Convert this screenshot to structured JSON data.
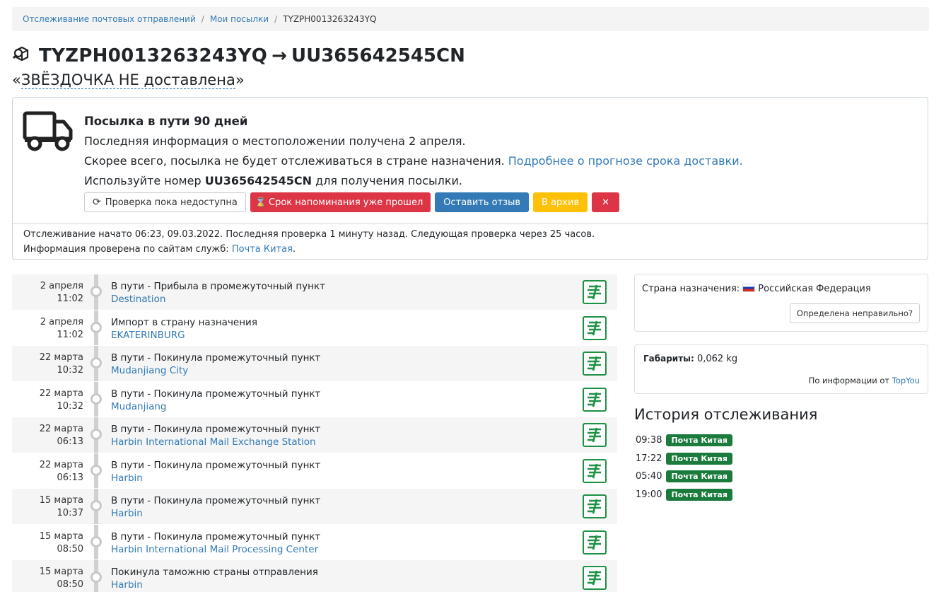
{
  "breadcrumb": {
    "home": "Отслеживание почтовых отправлений",
    "parcels": "Мои посылки",
    "current": "TYZPH0013263243YQ"
  },
  "title": {
    "tracking_number": "TYZPH0013263243YQ",
    "arrow": "→",
    "linked_number": "UU365642545CN",
    "name_quote_open": "«",
    "name": "ЗВЁЗДОЧКА НЕ доставлена",
    "name_quote_close": "»"
  },
  "status": {
    "heading": "Посылка в пути 90 дней",
    "line1": "Последняя информация о местоположении получена 2 апреля.",
    "line2": "Скорее всего, посылка не будет отслеживаться в стране назначения.",
    "line2_link": "Подробнее о прогнозе срока доставки.",
    "line3_pre": "Используйте номер",
    "line3_number": "UU365642545CN",
    "line3_post": "для получения посылки.",
    "buttons": {
      "check": "Проверка пока недоступна",
      "reminder": "Срок напоминания уже прошел",
      "review": "Оставить отзыв",
      "archive": "В архив",
      "delete": "✕"
    }
  },
  "info": {
    "line1": "Отслеживание начато 06:23, 09.03.2022. Последняя проверка 1 минуту назад. Следующая проверка через 25 часов.",
    "line2_pre": "Информация проверена по сайтам служб:",
    "line2_link": "Почта Китая",
    "line2_post": "."
  },
  "events": [
    {
      "date": "2 апреля",
      "time": "11:02",
      "status": "В пути - Прибыла в промежуточный пункт",
      "location": "Destination"
    },
    {
      "date": "2 апреля",
      "time": "11:02",
      "status": "Импорт в страну назначения",
      "location": "EKATERINBURG"
    },
    {
      "date": "22 марта",
      "time": "10:32",
      "status": "В пути - Покинула промежуточный пункт",
      "location": "Mudanjiang City"
    },
    {
      "date": "22 марта",
      "time": "10:32",
      "status": "В пути - Покинула промежуточный пункт",
      "location": "Mudanjiang"
    },
    {
      "date": "22 марта",
      "time": "06:13",
      "status": "В пути - Покинула промежуточный пункт",
      "location": "Harbin International Mail Exchange Station"
    },
    {
      "date": "22 марта",
      "time": "06:13",
      "status": "В пути - Покинула промежуточный пункт",
      "location": "Harbin"
    },
    {
      "date": "15 марта",
      "time": "10:37",
      "status": "В пути - Покинула промежуточный пункт",
      "location": "Harbin"
    },
    {
      "date": "15 марта",
      "time": "08:50",
      "status": "В пути - Покинула промежуточный пункт",
      "location": "Harbin International Mail Processing Center"
    },
    {
      "date": "15 марта",
      "time": "08:50",
      "status": "Покинула таможню страны отправления",
      "location": "Harbin"
    }
  ],
  "destination": {
    "label": "Страна назначения:",
    "country": "Российская Федерация",
    "wrong_button": "Определена неправильно?"
  },
  "dimensions": {
    "label": "Габариты:",
    "value": "0,062 kg",
    "source_pre": "По информации от",
    "source_link": "TopYou"
  },
  "history": {
    "title": "История отслеживания",
    "rows": [
      {
        "time": "09:38",
        "badge": "Почта Китая"
      },
      {
        "time": "17:22",
        "badge": "Почта Китая"
      },
      {
        "time": "05:40",
        "badge": "Почта Китая"
      },
      {
        "time": "19:00",
        "badge": "Почта Китая"
      }
    ]
  },
  "colors": {
    "link": "#337ab7",
    "danger": "#dc3545",
    "primary": "#337ab7",
    "warning": "#ffc107",
    "china_post_green": "#1e9145",
    "badge_green": "#1a7b3c"
  }
}
